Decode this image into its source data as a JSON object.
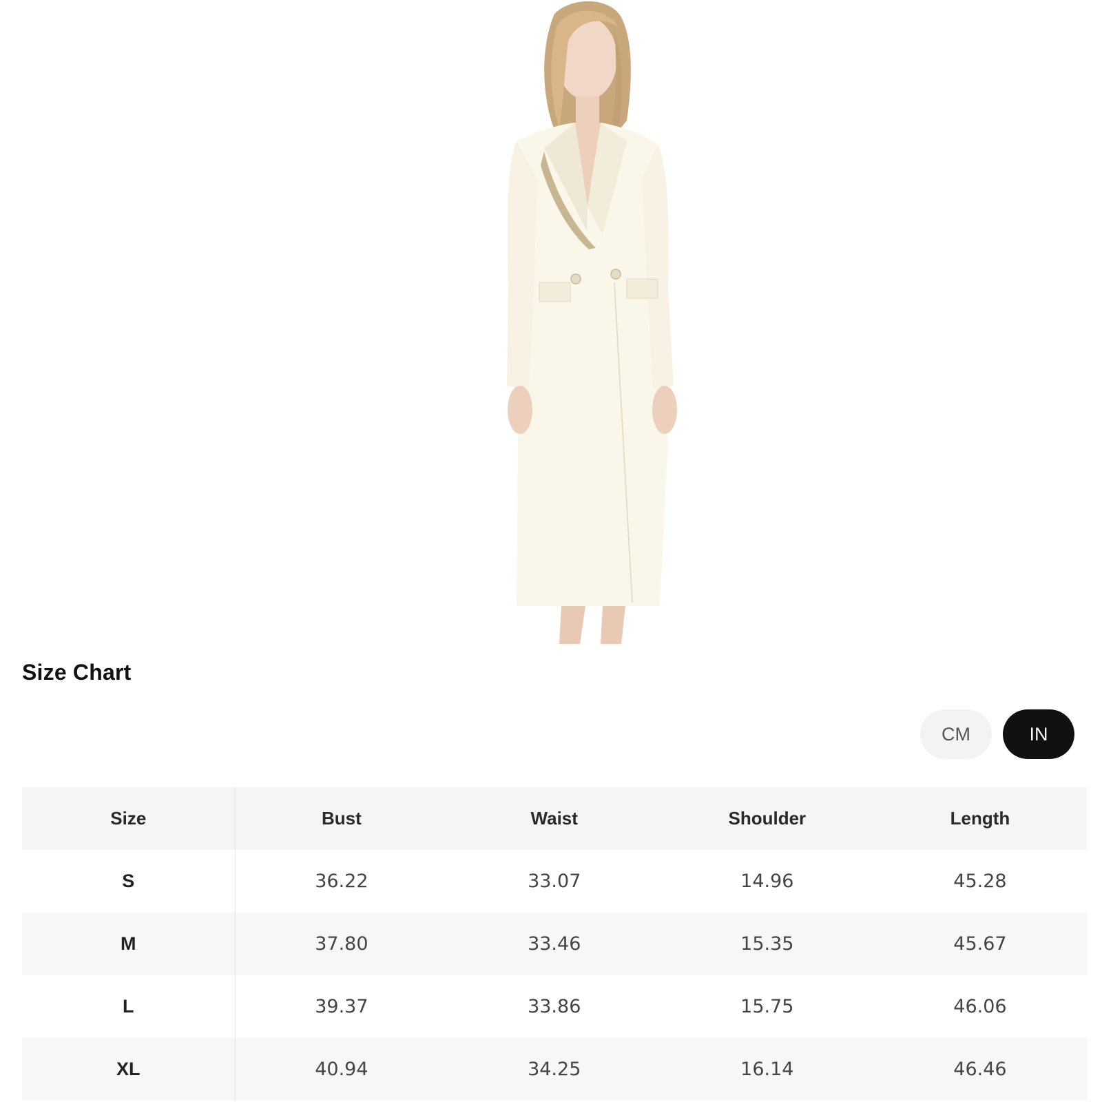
{
  "size_chart": {
    "title": "Size Chart",
    "units": {
      "cm_label": "CM",
      "in_label": "IN",
      "selected": "IN"
    },
    "columns": [
      "Size",
      "Bust",
      "Waist",
      "Shoulder",
      "Length"
    ],
    "rows": [
      {
        "size": "S",
        "bust": "36.22",
        "waist": "33.07",
        "shoulder": "14.96",
        "length": "45.28"
      },
      {
        "size": "M",
        "bust": "37.80",
        "waist": "33.46",
        "shoulder": "15.35",
        "length": "45.67"
      },
      {
        "size": "L",
        "bust": "39.37",
        "waist": "33.86",
        "shoulder": "15.75",
        "length": "46.06"
      },
      {
        "size": "XL",
        "bust": "40.94",
        "waist": "34.25",
        "shoulder": "16.14",
        "length": "46.46"
      }
    ]
  },
  "colors": {
    "active_toggle_bg": "#111111",
    "inactive_toggle_bg": "#f3f3f3",
    "header_row_bg": "#f5f5f5",
    "shaded_row_bg": "#f7f7f7",
    "garment": "#faf6ea"
  }
}
